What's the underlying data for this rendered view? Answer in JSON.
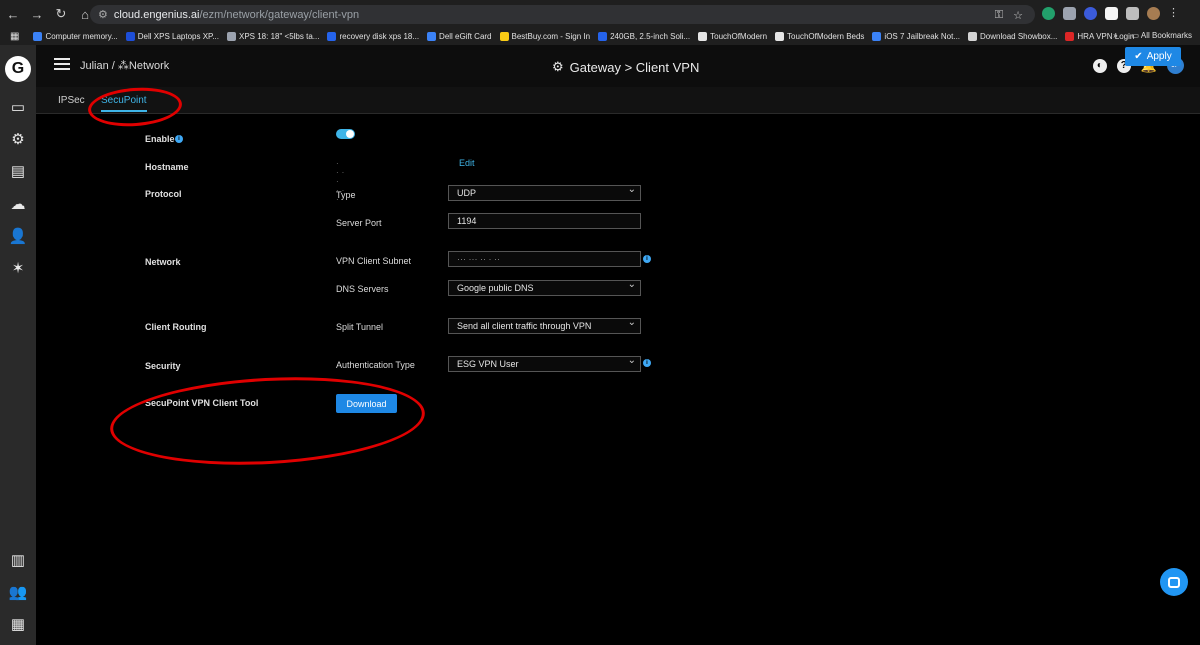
{
  "browser": {
    "url_host": "cloud.engenius.ai",
    "url_path": "/ezm/network/gateway/client-vpn",
    "bookmarks": [
      {
        "label": "Computer memory...",
        "color": "#3b82f6"
      },
      {
        "label": "Dell XPS Laptops XP...",
        "color": "#1d4ed8"
      },
      {
        "label": "XPS 18: 18\" <5lbs ta...",
        "color": "#9ca3af"
      },
      {
        "label": "recovery disk xps 18...",
        "color": "#2563eb"
      },
      {
        "label": "Dell eGift Card",
        "color": "#3b82f6"
      },
      {
        "label": "BestBuy.com - Sign In",
        "color": "#facc15"
      },
      {
        "label": "240GB, 2.5-inch Soli...",
        "color": "#2563eb"
      },
      {
        "label": "TouchOfModern",
        "color": "#e5e5e5"
      },
      {
        "label": "TouchOfModern Beds",
        "color": "#e5e5e5"
      },
      {
        "label": "iOS 7 Jailbreak Not...",
        "color": "#3b82f6"
      },
      {
        "label": "Download Showbox...",
        "color": "#d4d4d4"
      },
      {
        "label": "HRA VPN Login",
        "color": "#dc2626"
      }
    ],
    "more": "»",
    "all_bookmarks": "All Bookmarks"
  },
  "header": {
    "breadcrumb_user": "Julian",
    "breadcrumb_sep": " / ",
    "breadcrumb_network": "Network",
    "title": "Gateway > Client VPN",
    "notification_count": "99",
    "avatar_initials": "JP"
  },
  "tabs": [
    {
      "label": "IPSec"
    },
    {
      "label": "SecuPoint"
    }
  ],
  "apply_label": "Apply",
  "form": {
    "enable_label": "Enable",
    "hostname_label": "Hostname",
    "hostname_value": "· ·· · ·· ·",
    "edit_label": "Edit",
    "protocol_label": "Protocol",
    "type_label": "Type",
    "type_value": "UDP",
    "server_port_label": "Server Port",
    "server_port_value": "1194",
    "network_label": "Network",
    "vpn_subnet_label": "VPN Client Subnet",
    "vpn_subnet_value": "··· ··· ·· ·  ··",
    "dns_label": "DNS Servers",
    "dns_value": "Google public DNS",
    "client_routing_label": "Client Routing",
    "split_tunnel_label": "Split Tunnel",
    "split_tunnel_value": "Send all client traffic through VPN",
    "security_label": "Security",
    "auth_type_label": "Authentication Type",
    "auth_type_value": "ESG VPN User",
    "client_tool_label": "SecuPoint VPN Client Tool",
    "download_label": "Download"
  },
  "colors": {
    "accent": "#3fb5e8",
    "button_blue": "#1e88e5",
    "annotation_red": "#e00000"
  }
}
